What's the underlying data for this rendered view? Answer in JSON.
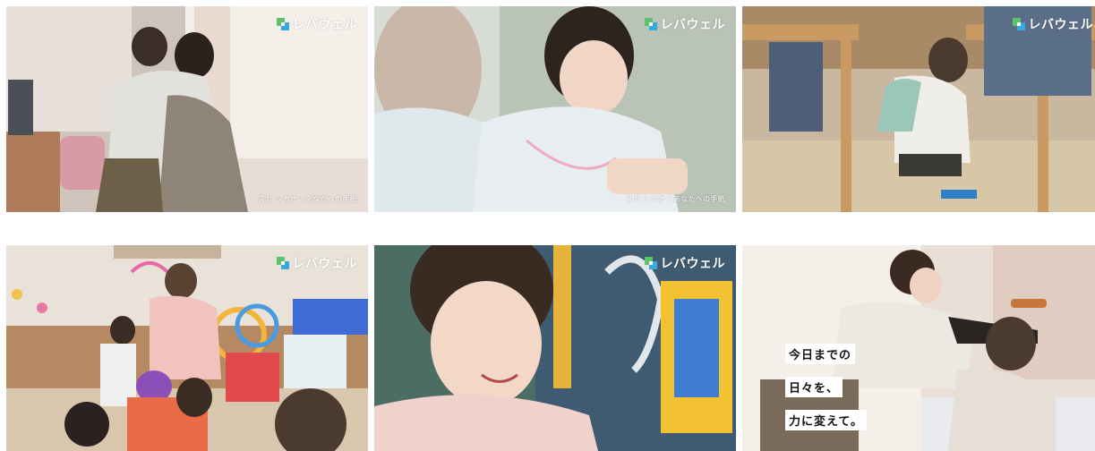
{
  "brand": {
    "logo_text": "レバウェル"
  },
  "colors": {
    "logo_green": "#5cc36a",
    "logo_blue": "#3aa8e0"
  },
  "frames": [
    {
      "credit": "スガ シカオ / あなたへの手紙"
    },
    {
      "credit": "スガ シカオ / あなたへの手紙"
    },
    {
      "credit": ""
    },
    {
      "credit": ""
    },
    {
      "credit": ""
    },
    {
      "credit": ""
    }
  ],
  "caption": {
    "lines": [
      "今日までの",
      "日々を、",
      "力に変えて。"
    ]
  }
}
